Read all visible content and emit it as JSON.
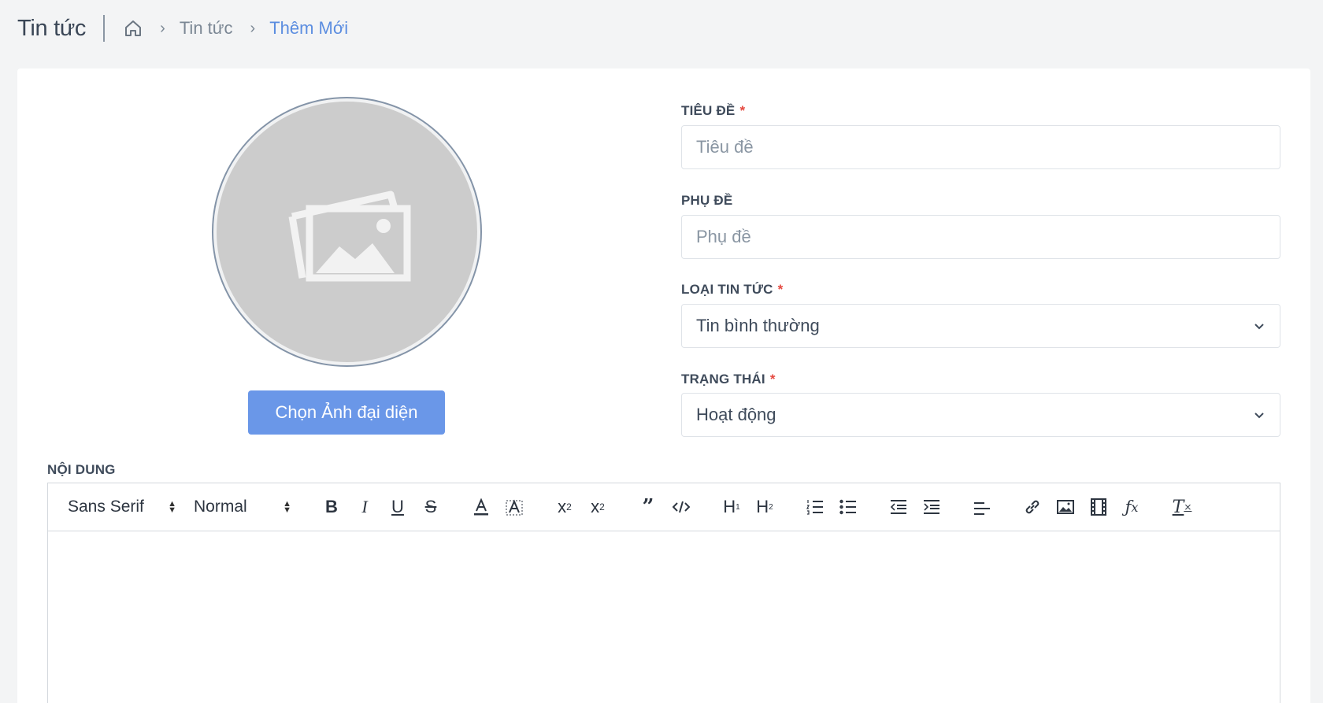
{
  "header": {
    "title": "Tin tức",
    "breadcrumb": [
      "Tin tức",
      "Thêm Mới"
    ]
  },
  "avatar": {
    "button_label": "Chọn Ảnh đại diện"
  },
  "form": {
    "title": {
      "label": "TIÊU ĐỀ",
      "required_mark": "*",
      "placeholder": "Tiêu đề",
      "value": ""
    },
    "subtitle": {
      "label": "PHỤ ĐỀ",
      "placeholder": "Phụ đề",
      "value": ""
    },
    "news_type": {
      "label": "LOẠI TIN TỨC",
      "required_mark": "*",
      "value": "Tin bình thường"
    },
    "status": {
      "label": "TRẠNG THÁI",
      "required_mark": "*",
      "value": "Hoạt động"
    },
    "content": {
      "label": "NỘI DUNG"
    }
  },
  "editor": {
    "font": "Sans Serif",
    "size": "Normal"
  },
  "colors": {
    "accent": "#6a97e8",
    "required": "#e5483f",
    "breadcrumb_active": "#5b8de0"
  }
}
